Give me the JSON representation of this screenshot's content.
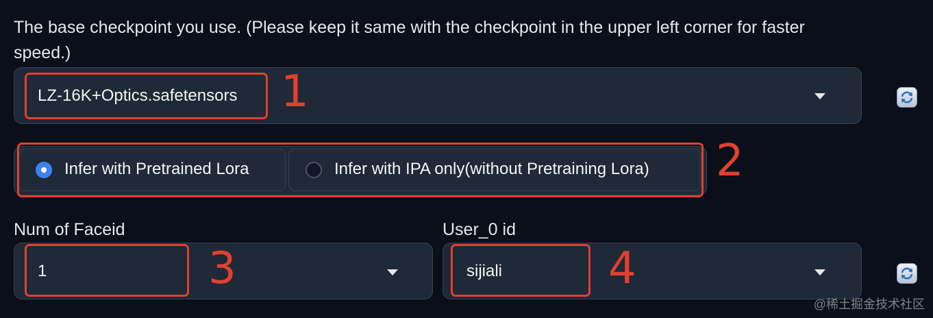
{
  "checkpoint": {
    "description": "The base checkpoint you use. (Please keep it same with the checkpoint in the upper left corner for faster speed.)",
    "selected": "LZ-16K+Optics.safetensors"
  },
  "mode": {
    "options": [
      {
        "label": "Infer with Pretrained Lora",
        "checked": true
      },
      {
        "label": "Infer with IPA only(without Pretraining Lora)",
        "checked": false
      }
    ]
  },
  "faceid": {
    "label": "Num of Faceid",
    "selected": "1"
  },
  "user": {
    "label": "User_0 id",
    "selected": "sijiali"
  },
  "annotations": {
    "n1": "1",
    "n2": "2",
    "n3": "3",
    "n4": "4"
  },
  "watermark": "@稀土掘金技术社区",
  "icons": {
    "refresh": "refresh-icon",
    "caret": "chevron-down-icon"
  },
  "colors": {
    "background": "#0b0f19",
    "panel": "#1f2937",
    "accent": "#3b82f6",
    "annotation": "#e2402f"
  }
}
